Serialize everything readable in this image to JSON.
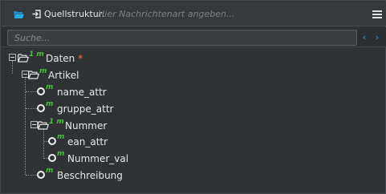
{
  "header": {
    "title": "Quellstruktur:",
    "message_type_placeholder": "Hier Nachrichtenart angeben...",
    "message_type_value": ""
  },
  "search": {
    "placeholder": "Suche...",
    "value": "",
    "prev_label": "‹",
    "next_label": "›"
  },
  "tree": {
    "root": {
      "cardinality": "1 m",
      "label": "Daten",
      "required_mark": "*"
    },
    "artikel": {
      "cardinality": "m",
      "label": "Artikel"
    },
    "name_attr": {
      "cardinality": "m",
      "label": "name_attr"
    },
    "gruppe_attr": {
      "cardinality": "m",
      "label": "gruppe_attr"
    },
    "nummer": {
      "cardinality": "1 m",
      "label": "Nummer"
    },
    "ean_attr": {
      "cardinality": "m",
      "label": "ean_attr"
    },
    "nummer_val": {
      "cardinality": "m",
      "label": "Nummer_val"
    },
    "beschreibung": {
      "cardinality": "m",
      "label": "Beschreibung"
    }
  },
  "colors": {
    "background": "#2f3235",
    "accent_blue": "#29a9e6",
    "cardinality_green": "#47c23a",
    "required_orange": "#f07a3c",
    "text": "#e8e8e8"
  },
  "icons": {
    "header_folder": "folder-open-icon",
    "header_import": "import-icon",
    "menu": "hamburger-menu-icon",
    "element_node": "folder-open-icon",
    "attribute_node": "attribute-circle-icon"
  }
}
